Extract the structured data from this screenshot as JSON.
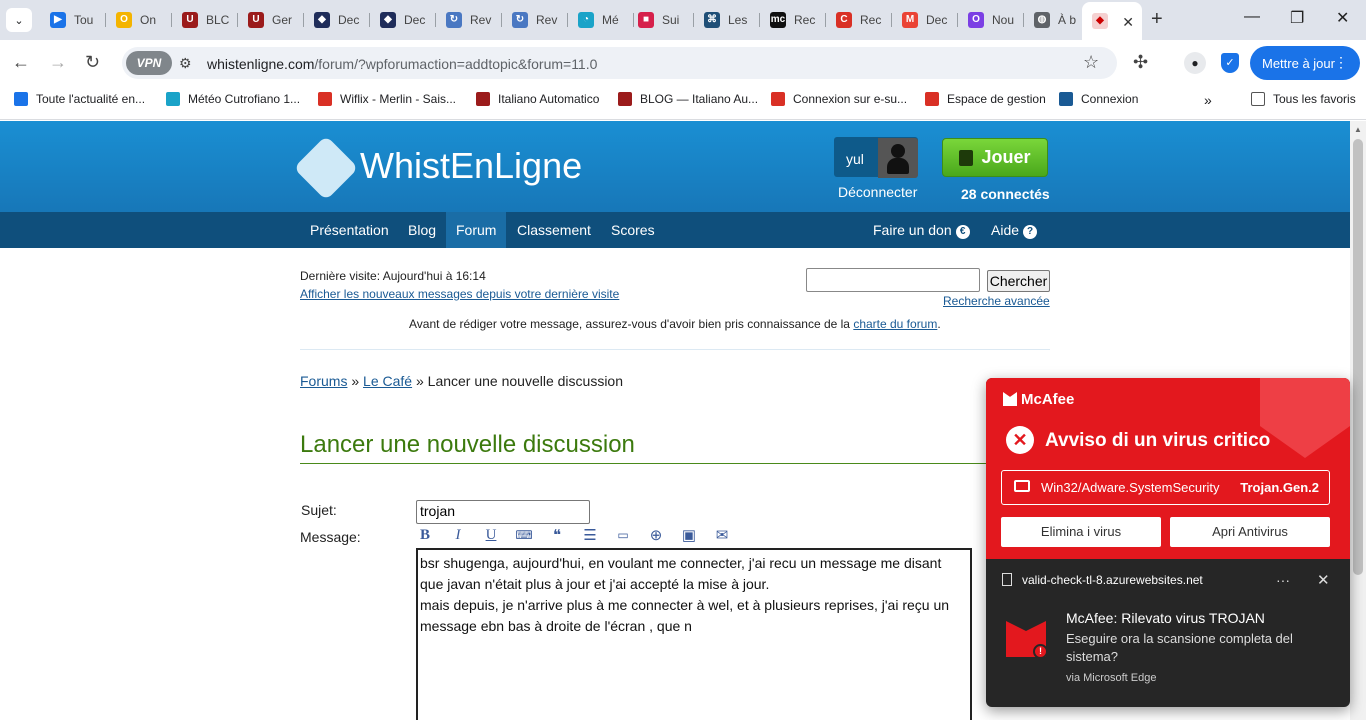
{
  "browser": {
    "tabs": [
      {
        "label": "Tou",
        "color": "#1a73e8",
        "glyph": "▶"
      },
      {
        "label": "On",
        "color": "#f4b400",
        "glyph": "O"
      },
      {
        "label": "BLC",
        "color": "#9b1b1b",
        "glyph": "U"
      },
      {
        "label": "Ger",
        "color": "#9b1b1b",
        "glyph": "U"
      },
      {
        "label": "Dec",
        "color": "#1f2d5a",
        "glyph": "◆"
      },
      {
        "label": "Dec",
        "color": "#1f2d5a",
        "glyph": "◆"
      },
      {
        "label": "Rev",
        "color": "#4a78c2",
        "glyph": "↻"
      },
      {
        "label": "Rev",
        "color": "#4a78c2",
        "glyph": "↻"
      },
      {
        "label": "Mé",
        "color": "#1aa3c8",
        "glyph": "◔"
      },
      {
        "label": "Sui",
        "color": "#d6204b",
        "glyph": "■"
      },
      {
        "label": "Les",
        "color": "#1f4f77",
        "glyph": "⌘"
      },
      {
        "label": "Rec",
        "color": "#111111",
        "glyph": "mc"
      },
      {
        "label": "Rec",
        "color": "#d93025",
        "glyph": "C"
      },
      {
        "label": "Dec",
        "color": "#ea4335",
        "glyph": "M"
      },
      {
        "label": "Nou",
        "color": "#7b3fe4",
        "glyph": "O"
      },
      {
        "label": "À b",
        "color": "#5f6368",
        "glyph": "◍"
      }
    ],
    "active_tab_label": "",
    "url_host": "whistenligne.com",
    "url_path": "/forum/?wpforumaction=addtopic&forum=11.0",
    "vpn_label": "VPN",
    "update_button": "Mettre à jour",
    "bookmarks": [
      {
        "label": "Toute l'actualité en...",
        "color": "#1a73e8"
      },
      {
        "label": "Météo Cutrofiano 1...",
        "color": "#1aa3c8"
      },
      {
        "label": "Wiflix - Merlin - Sais...",
        "color": "#d93025"
      },
      {
        "label": "Italiano Automatico",
        "color": "#9b1b1b"
      },
      {
        "label": "BLOG — Italiano Au...",
        "color": "#9b1b1b"
      },
      {
        "label": "Connexion sur e-su...",
        "color": "#d93025"
      },
      {
        "label": "Espace de gestion",
        "color": "#d93025"
      },
      {
        "label": "Connexion",
        "color": "#1a5a94"
      }
    ],
    "all_bookmarks": "Tous les favoris"
  },
  "site": {
    "logo": "WhistEnLigne",
    "username": "yul",
    "logout": "Déconnecter",
    "play_button": "Jouer",
    "online_count": "28 connectés",
    "nav": [
      "Présentation",
      "Blog",
      "Forum",
      "Classement",
      "Scores"
    ],
    "nav_right": [
      "Faire un don",
      "Aide"
    ]
  },
  "forum": {
    "last_visit": "Dernière visite: Aujourd'hui à 16:14",
    "new_messages_link": "Afficher les nouveaux messages depuis votre dernière visite",
    "search_button": "Chercher",
    "advanced_search": "Recherche avancée",
    "notice_prefix": "Avant de rédiger votre message, assurez-vous d'avoir bien pris connaissance de la ",
    "notice_link": "charte du forum",
    "notice_suffix": ".",
    "breadcrumb": {
      "forums": "Forums",
      "sep": "»",
      "cafe": "Le Café",
      "current": "Lancer une nouvelle discussion"
    },
    "page_title": "Lancer une nouvelle discussion",
    "subject_label": "Sujet:",
    "subject_value": "trojan",
    "message_label": "Message:",
    "message_value": "bsr shugenga, aujourd'hui, en voulant me connecter, j'ai recu un message me disant que javan n'était plus à jour et j'ai accepté la mise à jour.\nmais depuis, je n'arrive plus à me connecter à wel, et à plusieurs reprises, j'ai reçu un message ebn bas à droite de l'écran , que n"
  },
  "popup": {
    "brand": "McAfee",
    "title": "Avviso di un virus critico",
    "file_name": "Win32/Adware.SystemSecurity",
    "virus_name": "Trojan.Gen.2",
    "remove_button": "Elimina i virus",
    "open_button": "Apri Antivirus",
    "source": "valid-check-tl-8.azurewebsites.net",
    "notif_title": "McAfee: Rilevato virus TROJAN",
    "notif_body": "Eseguire ora la scansione completa del sistema?",
    "via": "via Microsoft Edge"
  }
}
